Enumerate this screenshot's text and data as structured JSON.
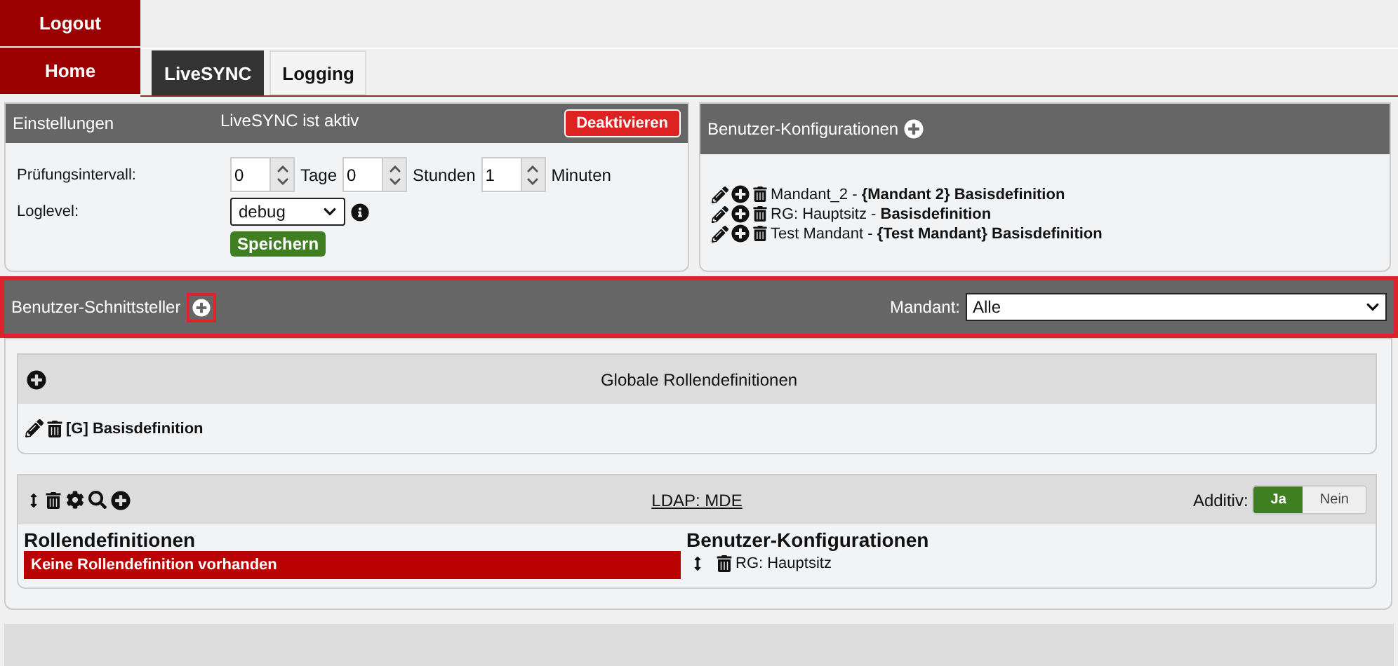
{
  "nav": [
    {
      "label": "Logout"
    },
    {
      "label": "Home"
    }
  ],
  "tabs": [
    {
      "label": "LiveSYNC",
      "selected": true
    },
    {
      "label": "Logging",
      "selected": false
    }
  ],
  "settings": {
    "title": "Einstellungen",
    "status": "LiveSYNC ist aktiv",
    "deactivate_button": "Deaktivieren",
    "interval_label": "Prüfungsintervall:",
    "interval_fields": [
      {
        "value": "0",
        "unit": "Tage"
      },
      {
        "value": "0",
        "unit": "Stunden"
      },
      {
        "value": "1",
        "unit": "Minuten"
      }
    ],
    "loglevel_label": "Loglevel:",
    "loglevel_value": "debug",
    "save_button": "Speichern"
  },
  "configurations": {
    "title": "Benutzer-Konfigurationen",
    "items": [
      "Mandant_2 - **{Mandant 2} Basisdefinition**",
      "RG: Hauptsitz - **Basisdefinition**",
      "Test Mandant - **{Test Mandant} Basisdefinition**"
    ]
  },
  "interfaces": {
    "title": "Benutzer-Schnittsteller",
    "mandant_label": "Mandant:",
    "mandant_value": "Alle",
    "global": {
      "title": "Globale Rollendefinitionen",
      "items": [
        "[G] Basisdefinition"
      ]
    },
    "ldap": {
      "title": "LDAP: MDE",
      "additiv_label": "Additiv:",
      "options": [
        {
          "label": "Ja",
          "selected": true
        },
        {
          "label": "Nein",
          "selected": false
        }
      ],
      "roles_heading": "Rollendefinitionen",
      "roles_empty": "Keine Rollendefinition vorhanden",
      "configs_heading": "Benutzer-Konfigurationen",
      "config_items": [
        "RG: Hauptsitz"
      ]
    }
  }
}
